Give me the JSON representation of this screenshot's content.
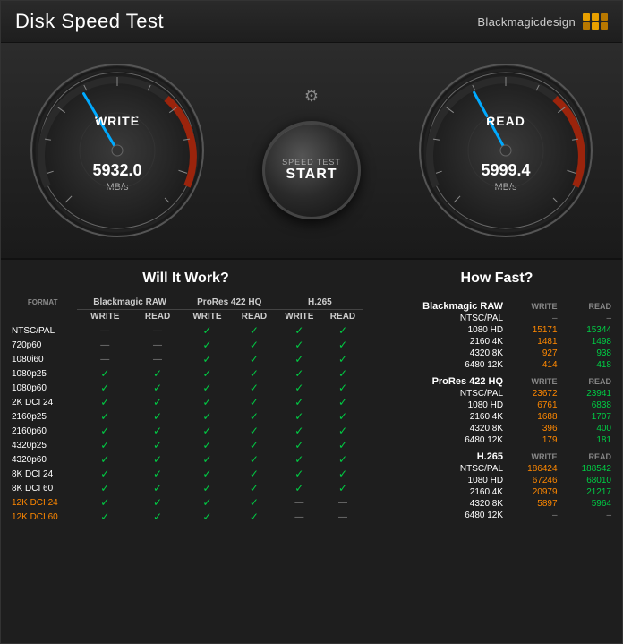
{
  "titleBar": {
    "title": "Disk Speed Test",
    "brand": "Blackmagicdesign"
  },
  "gauges": {
    "write": {
      "label": "WRITE",
      "value": "5932.0",
      "unit": "MB/s"
    },
    "read": {
      "label": "READ",
      "value": "5999.4",
      "unit": "MB/s"
    }
  },
  "startButton": {
    "line1": "SPEED TEST",
    "line2": "START"
  },
  "willItWork": {
    "title": "Will It Work?",
    "columns": {
      "format": "FORMAT",
      "braw": "Blackmagic RAW",
      "prores": "ProRes 422 HQ",
      "h265": "H.265"
    },
    "subHeaders": [
      "WRITE",
      "READ",
      "WRITE",
      "READ",
      "WRITE",
      "READ"
    ],
    "rows": [
      {
        "label": "NTSC/PAL",
        "orange": false,
        "braw_w": "—",
        "braw_r": "—",
        "pro_w": "✓",
        "pro_r": "✓",
        "h265_w": "✓",
        "h265_r": "✓"
      },
      {
        "label": "720p60",
        "orange": false,
        "braw_w": "—",
        "braw_r": "—",
        "pro_w": "✓",
        "pro_r": "✓",
        "h265_w": "✓",
        "h265_r": "✓"
      },
      {
        "label": "1080i60",
        "orange": false,
        "braw_w": "—",
        "braw_r": "—",
        "pro_w": "✓",
        "pro_r": "✓",
        "h265_w": "✓",
        "h265_r": "✓"
      },
      {
        "label": "1080p25",
        "orange": false,
        "braw_w": "✓",
        "braw_r": "✓",
        "pro_w": "✓",
        "pro_r": "✓",
        "h265_w": "✓",
        "h265_r": "✓"
      },
      {
        "label": "1080p60",
        "orange": false,
        "braw_w": "✓",
        "braw_r": "✓",
        "pro_w": "✓",
        "pro_r": "✓",
        "h265_w": "✓",
        "h265_r": "✓"
      },
      {
        "label": "2K DCI 24",
        "orange": false,
        "braw_w": "✓",
        "braw_r": "✓",
        "pro_w": "✓",
        "pro_r": "✓",
        "h265_w": "✓",
        "h265_r": "✓"
      },
      {
        "label": "2160p25",
        "orange": false,
        "braw_w": "✓",
        "braw_r": "✓",
        "pro_w": "✓",
        "pro_r": "✓",
        "h265_w": "✓",
        "h265_r": "✓"
      },
      {
        "label": "2160p60",
        "orange": false,
        "braw_w": "✓",
        "braw_r": "✓",
        "pro_w": "✓",
        "pro_r": "✓",
        "h265_w": "✓",
        "h265_r": "✓"
      },
      {
        "label": "4320p25",
        "orange": false,
        "braw_w": "✓",
        "braw_r": "✓",
        "pro_w": "✓",
        "pro_r": "✓",
        "h265_w": "✓",
        "h265_r": "✓"
      },
      {
        "label": "4320p60",
        "orange": false,
        "braw_w": "✓",
        "braw_r": "✓",
        "pro_w": "✓",
        "pro_r": "✓",
        "h265_w": "✓",
        "h265_r": "✓"
      },
      {
        "label": "8K DCI 24",
        "orange": false,
        "braw_w": "✓",
        "braw_r": "✓",
        "pro_w": "✓",
        "pro_r": "✓",
        "h265_w": "✓",
        "h265_r": "✓"
      },
      {
        "label": "8K DCI 60",
        "orange": false,
        "braw_w": "✓",
        "braw_r": "✓",
        "pro_w": "✓",
        "pro_r": "✓",
        "h265_w": "✓",
        "h265_r": "✓"
      },
      {
        "label": "12K DCI 24",
        "orange": true,
        "braw_w": "✓",
        "braw_r": "✓",
        "pro_w": "✓",
        "pro_r": "✓",
        "h265_w": "—",
        "h265_r": "—"
      },
      {
        "label": "12K DCI 60",
        "orange": true,
        "braw_w": "✓",
        "braw_r": "✓",
        "pro_w": "✓",
        "pro_r": "✓",
        "h265_w": "—",
        "h265_r": "—"
      }
    ]
  },
  "howFast": {
    "title": "How Fast?",
    "sections": [
      {
        "name": "Blackmagic RAW",
        "writeHeader": "WRITE",
        "readHeader": "READ",
        "rows": [
          {
            "label": "NTSC/PAL",
            "write": "–",
            "read": "–"
          },
          {
            "label": "1080 HD",
            "write": "15171",
            "read": "15344"
          },
          {
            "label": "2160 4K",
            "write": "1481",
            "read": "1498"
          },
          {
            "label": "4320 8K",
            "write": "927",
            "read": "938"
          },
          {
            "label": "6480 12K",
            "write": "414",
            "read": "418"
          }
        ]
      },
      {
        "name": "ProRes 422 HQ",
        "writeHeader": "WRITE",
        "readHeader": "READ",
        "rows": [
          {
            "label": "NTSC/PAL",
            "write": "23672",
            "read": "23941"
          },
          {
            "label": "1080 HD",
            "write": "6761",
            "read": "6838"
          },
          {
            "label": "2160 4K",
            "write": "1688",
            "read": "1707"
          },
          {
            "label": "4320 8K",
            "write": "396",
            "read": "400"
          },
          {
            "label": "6480 12K",
            "write": "179",
            "read": "181"
          }
        ]
      },
      {
        "name": "H.265",
        "writeHeader": "WRITE",
        "readHeader": "READ",
        "rows": [
          {
            "label": "NTSC/PAL",
            "write": "186424",
            "read": "188542"
          },
          {
            "label": "1080 HD",
            "write": "67246",
            "read": "68010"
          },
          {
            "label": "2160 4K",
            "write": "20979",
            "read": "21217"
          },
          {
            "label": "4320 8K",
            "write": "5897",
            "read": "5964"
          },
          {
            "label": "6480 12K",
            "write": "–",
            "read": "–"
          }
        ]
      }
    ]
  }
}
